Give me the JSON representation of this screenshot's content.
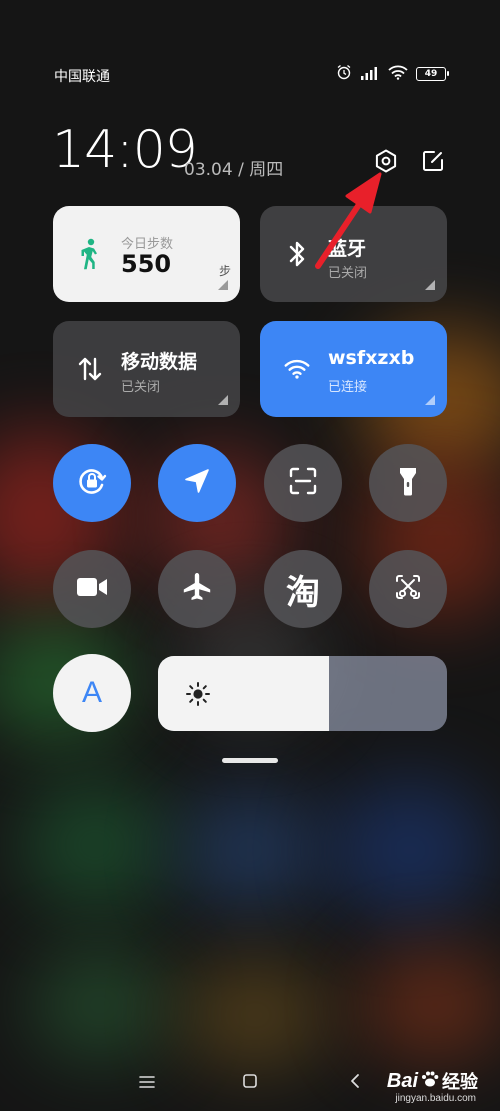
{
  "status": {
    "carrier": "中国联通",
    "battery": "49"
  },
  "header": {
    "time": "14:09",
    "date": "03.04 / 周四"
  },
  "tiles": {
    "steps": {
      "label": "今日步数",
      "value": "550",
      "unit": "步"
    },
    "bluetooth": {
      "title": "蓝牙",
      "status": "已关闭"
    },
    "mobile_data": {
      "title": "移动数据",
      "status": "已关闭"
    },
    "wifi": {
      "title": "wsfxzxb",
      "status": "已连接"
    }
  },
  "toggles": {
    "taobao_glyph": "淘",
    "font_glyph": "A"
  },
  "brightness": {
    "level": 0.59
  },
  "watermark": {
    "brand": "Bai",
    "cn": "经验",
    "url": "jingyan.baidu.com"
  },
  "colors": {
    "accent": "#3d86f5",
    "tile_dark": "#3a3a3c",
    "tile_light": "#f2f2f2",
    "arrow": "#e8202a"
  },
  "icons": {
    "settings": "hexagon-gear-icon",
    "edit": "edit-icon",
    "walk": "walking-person-icon",
    "bluetooth": "bluetooth-icon",
    "data": "data-arrows-icon",
    "wifi": "wifi-icon"
  }
}
